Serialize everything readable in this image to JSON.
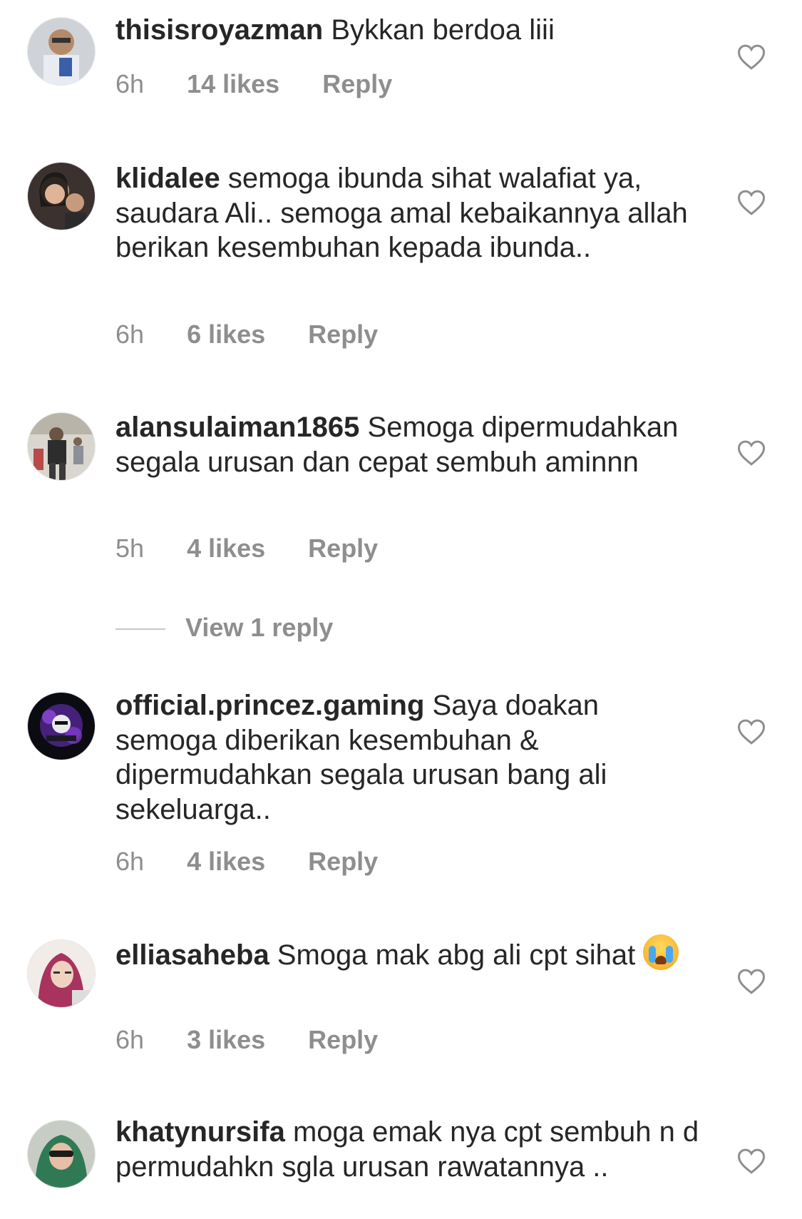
{
  "comments": [
    {
      "username": "thisisroyazman",
      "text": " Bykkan berdoa liii",
      "time": "6h",
      "likes": "14 likes",
      "reply": "Reply"
    },
    {
      "username": "klidalee",
      "text": " semoga ibunda sihat walafiat ya, saudara Ali.. semoga amal kebaikannya allah berikan kesembuhan kepada ibunda..",
      "time": "6h",
      "likes": "6 likes",
      "reply": "Reply"
    },
    {
      "username": "alansulaiman1865",
      "text": " Semoga dipermudahkan segala urusan dan cepat sembuh aminnn",
      "time": "5h",
      "likes": "4 likes",
      "reply": "Reply",
      "view_replies": "View 1 reply"
    },
    {
      "username": "official.princez.gaming",
      "text": " Saya doakan semoga diberikan kesembuhan & dipermudahkan segala urusan bang ali sekeluarga..",
      "time": "6h",
      "likes": "4 likes",
      "reply": "Reply"
    },
    {
      "username": "elliasaheba",
      "text": " Smoga mak abg ali cpt sihat",
      "emoji": "loudly-crying-face",
      "time": "6h",
      "likes": "3 likes",
      "reply": "Reply"
    },
    {
      "username": "khatynursifa",
      "text": " moga emak nya cpt sembuh n d permudahkn sgla urusan rawatannya .."
    }
  ],
  "icons": {
    "like": "heart-outline-icon"
  },
  "colors": {
    "text": "#262626",
    "secondary": "#8e8e8e",
    "heart_stroke": "#8e8e8e"
  }
}
